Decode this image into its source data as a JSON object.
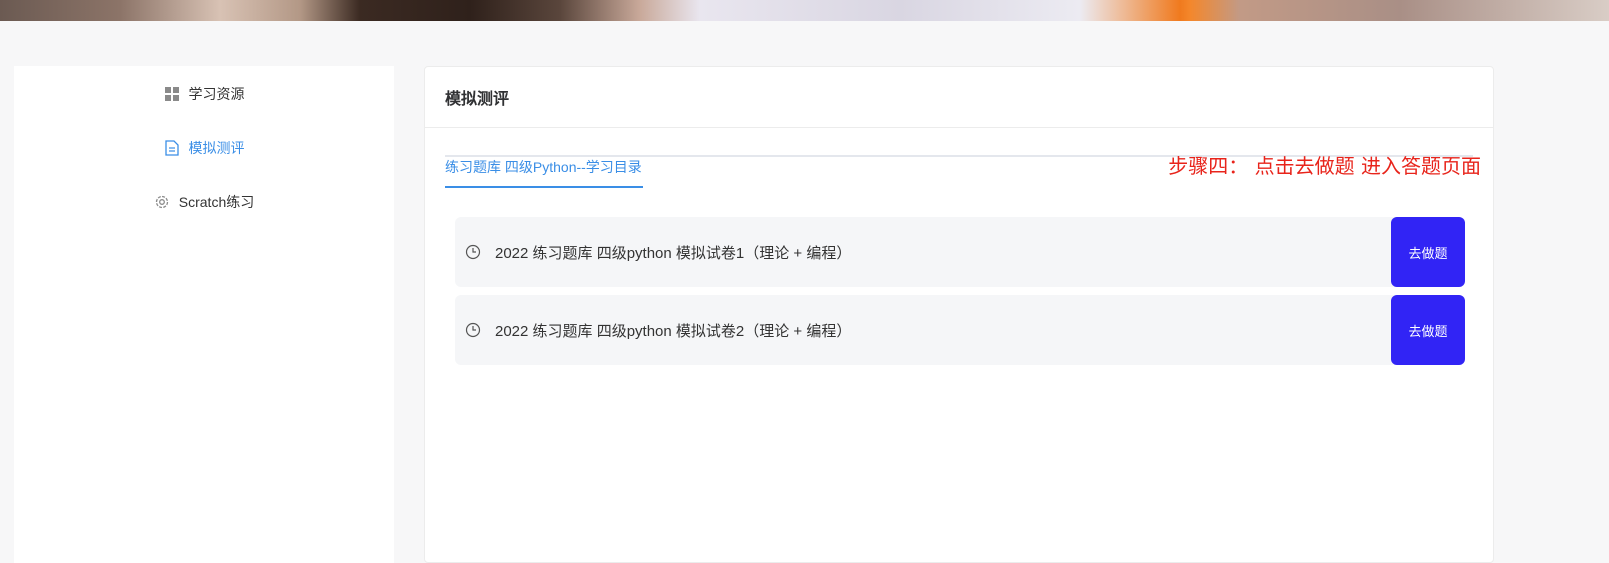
{
  "sidebar": {
    "items": [
      {
        "label": "学习资源",
        "icon": "grid-icon",
        "active": false
      },
      {
        "label": "模拟测评",
        "icon": "document-icon",
        "active": true
      },
      {
        "label": "Scratch练习",
        "icon": "gear-icon",
        "active": false
      }
    ]
  },
  "main": {
    "title": "模拟测评",
    "tab_label": "练习题库 四级Python--学习目录",
    "step_note": "步骤四：  点击去做题 进入答题页面",
    "exams": [
      {
        "title": "2022 练习题库 四级python 模拟试卷1（理论 + 编程）",
        "button_label": "去做题",
        "icon": "clock-icon"
      },
      {
        "title": "2022 练习题库 四级python 模拟试卷2（理论 + 编程）",
        "button_label": "去做题",
        "icon": "clock-icon"
      }
    ]
  },
  "colors": {
    "accent": "#3a8ee6",
    "button": "#3124f5",
    "note": "#e8241b"
  }
}
